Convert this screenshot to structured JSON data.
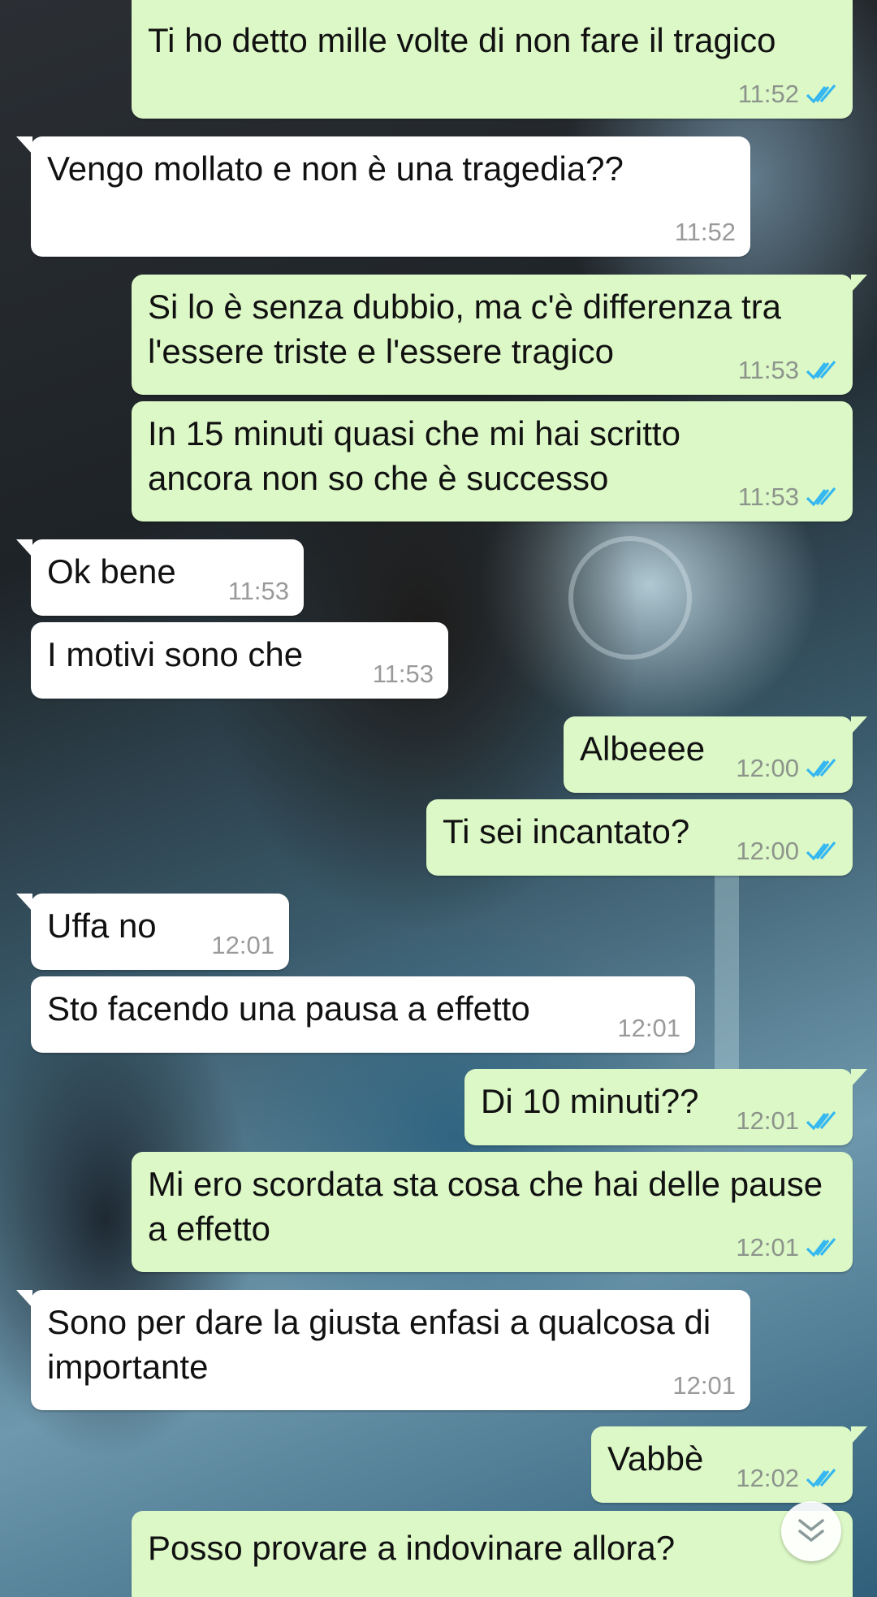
{
  "conversation": {
    "messages": [
      {
        "dir": "out",
        "text": "Ti ho detto mille volte di non fare il tragico",
        "time": "11:52",
        "read": true
      },
      {
        "dir": "in",
        "text": "Vengo mollato e non è una tragedia??",
        "time": "11:52"
      },
      {
        "dir": "out",
        "text": "Si lo è senza dubbio, ma c'è differenza tra l'essere triste e l'essere tragico",
        "time": "11:53",
        "read": true
      },
      {
        "dir": "out",
        "text": "In 15 minuti quasi che mi hai scritto ancora non so che è successo",
        "time": "11:53",
        "read": true
      },
      {
        "dir": "in",
        "text": "Ok bene",
        "time": "11:53"
      },
      {
        "dir": "in",
        "text": "I motivi sono che",
        "time": "11:53"
      },
      {
        "dir": "out",
        "text": "Albeeee",
        "time": "12:00",
        "read": true
      },
      {
        "dir": "out",
        "text": "Ti sei incantato?",
        "time": "12:00",
        "read": true
      },
      {
        "dir": "in",
        "text": "Uffa no",
        "time": "12:01"
      },
      {
        "dir": "in",
        "text": "Sto facendo una pausa a effetto",
        "time": "12:01"
      },
      {
        "dir": "out",
        "text": "Di 10 minuti??",
        "time": "12:01",
        "read": true
      },
      {
        "dir": "out",
        "text": "Mi ero scordata sta cosa che hai delle pause a effetto",
        "time": "12:01",
        "read": true
      },
      {
        "dir": "in",
        "text": "Sono per dare la giusta enfasi a qualcosa di importante",
        "time": "12:01"
      },
      {
        "dir": "out",
        "text": "Vabbè",
        "time": "12:02",
        "read": true
      },
      {
        "dir": "out",
        "text": "Posso provare a indovinare allora?",
        "time": "",
        "read": false
      }
    ]
  },
  "icons": {
    "read_receipt": "double-check-icon",
    "scroll_down": "chevron-down-icon"
  },
  "colors": {
    "incoming_bubble": "#ffffff",
    "outgoing_bubble": "#dcf8c6",
    "read_check": "#34b7f1",
    "time_text": "#8c948c"
  }
}
